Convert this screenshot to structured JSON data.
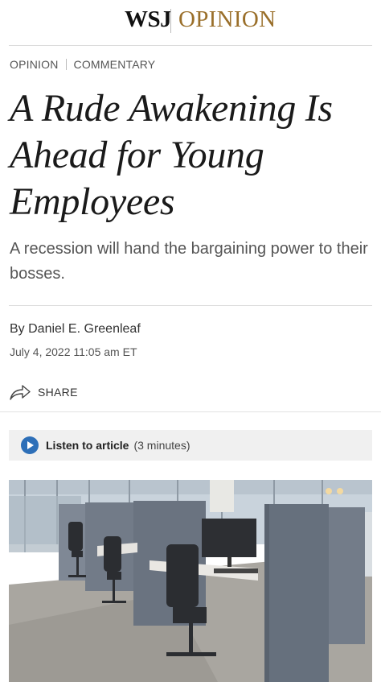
{
  "masthead": {
    "brand": "WSJ",
    "section": "OPINION"
  },
  "kicker": {
    "section": "OPINION",
    "category": "COMMENTARY"
  },
  "article": {
    "headline": "A Rude Awakening Is Ahead for Young Employees",
    "dek": "A recession will hand the bargaining power to their bosses.",
    "byline_prefix": "By ",
    "author": "Daniel E. Greenleaf",
    "date": "July 4, 2022 11:05 am ET"
  },
  "share": {
    "label": "SHARE",
    "icon": "share-arrow-icon"
  },
  "audio": {
    "label": "Listen to article",
    "duration": "(3 minutes)",
    "icon": "play-icon",
    "accent": "#2d6fb8"
  },
  "colors": {
    "opinion_gold": "#9a6f2a",
    "rule": "#dcdcdc",
    "audio_bg": "#f0f0f0"
  },
  "image": {
    "subject": "office cubicles with gray partitions and desk chairs"
  }
}
